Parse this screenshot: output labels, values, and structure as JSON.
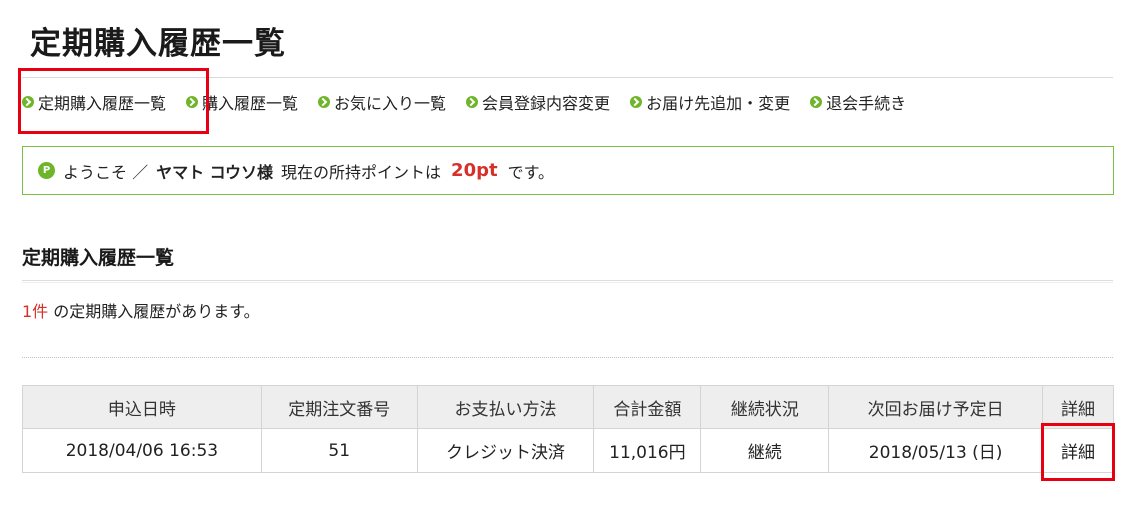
{
  "page": {
    "title": "定期購入履歴一覧"
  },
  "nav": {
    "items": [
      {
        "label": "定期購入履歴一覧"
      },
      {
        "label": "購入履歴一覧"
      },
      {
        "label": "お気に入り一覧"
      },
      {
        "label": "会員登録内容変更"
      },
      {
        "label": "お届け先追加・変更"
      },
      {
        "label": "退会手続き"
      }
    ]
  },
  "welcome": {
    "icon_letter": "P",
    "greeting": "ようこそ ／",
    "name": "ヤマト コウソ様",
    "points_prefix": "現在の所持ポイントは",
    "points": "20pt",
    "points_suffix": "です。"
  },
  "section": {
    "title": "定期購入履歴一覧"
  },
  "summary": {
    "count": "1件",
    "text": "の定期購入履歴があります。"
  },
  "table": {
    "headers": [
      "申込日時",
      "定期注文番号",
      "お支払い方法",
      "合計金額",
      "継続状況",
      "次回お届け予定日",
      "詳細"
    ],
    "rows": [
      [
        "2018/04/06 16:53",
        "51",
        "クレジット決済",
        "11,016円",
        "継続",
        "2018/05/13 (日)",
        "詳細"
      ]
    ]
  },
  "colors": {
    "accent_green": "#6fb52c",
    "highlight_red": "#e60012",
    "point_red": "#d6302a"
  }
}
